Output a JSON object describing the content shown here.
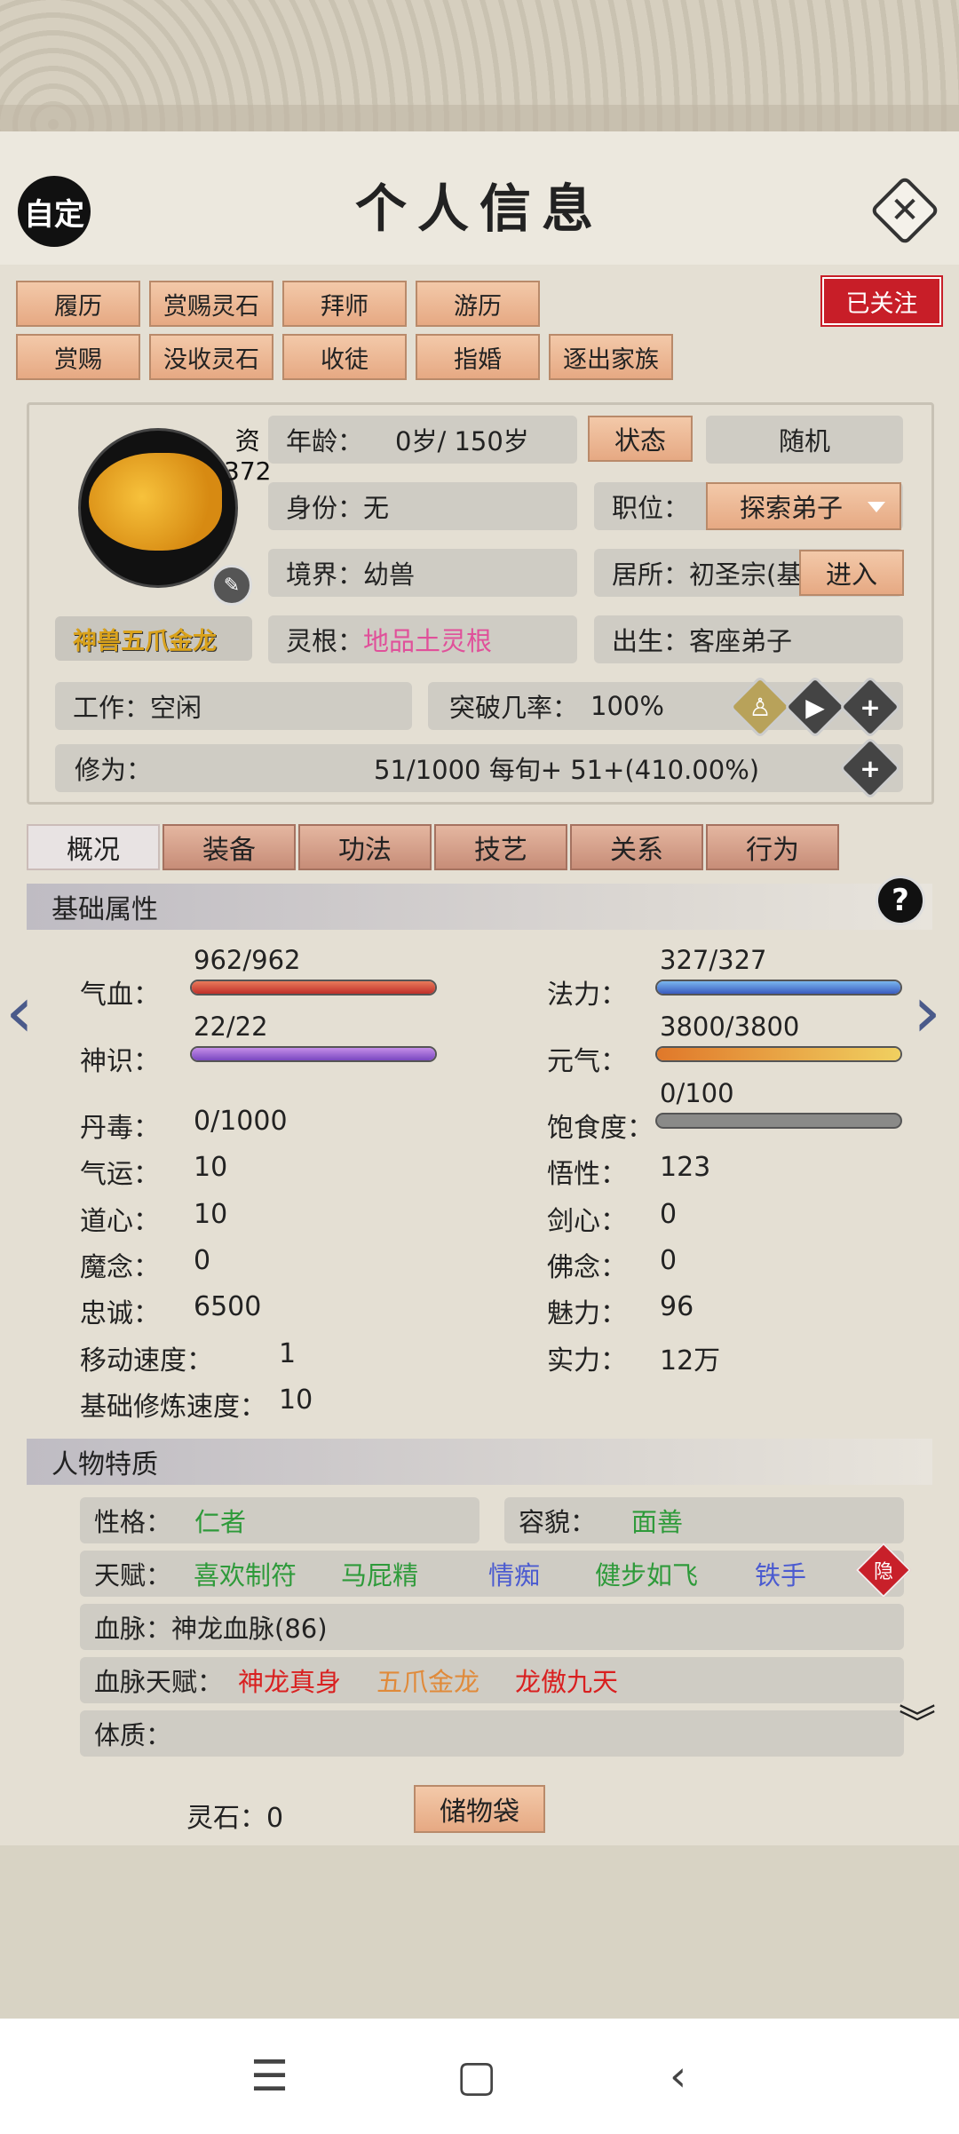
{
  "header": {
    "title": "个人信息",
    "auto_label": "自定"
  },
  "action_buttons": [
    "履历",
    "赏赐灵石",
    "拜师",
    "游历",
    "赏赐",
    "没收灵石",
    "收徒",
    "指婚",
    "逐出家族"
  ],
  "follow_label": "已关注",
  "profile": {
    "zi_label": "资",
    "zi_value": "372",
    "name": "神兽五爪金龙",
    "age_label": "年龄：",
    "age_value": "0岁/ 150岁",
    "status_btn": "状态",
    "random_btn": "随机",
    "identity_label": "身份：",
    "identity_value": "无",
    "position_label": "职位：",
    "position_value": "探索弟子",
    "realm_label": "境界：",
    "realm_value": "幼兽",
    "residence_label": "居所：初圣宗(基",
    "enter_btn": "进入",
    "root_label": "灵根：",
    "root_value": "地品土灵根",
    "birth_label": "出生：",
    "birth_value": "客座弟子",
    "work_label": "工作：空闲",
    "breakthrough_label": "突破几率：",
    "breakthrough_value": "100%",
    "cultivation_label": "修为：",
    "cultivation_value": "51/1000  每旬+  51+(410.00%)"
  },
  "tabs": [
    "概况",
    "装备",
    "功法",
    "技艺",
    "关系",
    "行为"
  ],
  "basic": {
    "section_title": "基础属性",
    "hp_label": "气血：",
    "hp_value": "962/962",
    "hp_frac": 1.0,
    "mp_label": "法力：",
    "mp_value": "327/327",
    "mp_frac": 1.0,
    "sense_label": "神识：",
    "sense_value": "22/22",
    "sense_frac": 1.0,
    "qi_label": "元气：",
    "qi_value": "3800/3800",
    "qi_frac": 1.0,
    "satiety_label": "饱食度：",
    "satiety_value": "0/100",
    "satiety_frac": 0.0,
    "left_stats": [
      {
        "label": "丹毒：",
        "value": "0/1000"
      },
      {
        "label": "气运：",
        "value": "10"
      },
      {
        "label": "道心：",
        "value": "10"
      },
      {
        "label": "魔念：",
        "value": "0"
      },
      {
        "label": "忠诚：",
        "value": "6500"
      },
      {
        "label": "移动速度：",
        "value": "1"
      },
      {
        "label": "基础修炼速度：",
        "value": "10"
      }
    ],
    "right_stats": [
      {
        "label": "悟性：",
        "value": "123"
      },
      {
        "label": "剑心：",
        "value": "0"
      },
      {
        "label": "佛念：",
        "value": "0"
      },
      {
        "label": "魅力：",
        "value": "96"
      },
      {
        "label": "实力：",
        "value": "12万"
      }
    ]
  },
  "traits": {
    "section_title": "人物特质",
    "personality_label": "性格：",
    "personality_value": "仁者",
    "looks_label": "容貌：",
    "looks_value": "面善",
    "talent_label": "天赋：",
    "talents": [
      "喜欢制符",
      "马屁精",
      "情痴",
      "健步如飞",
      "铁手"
    ],
    "hide_label": "隐",
    "bloodline_label": "血脉：神龙血脉(86)",
    "bloodline_talent_label": "血脉天赋：",
    "bloodline_talents": [
      "神龙真身",
      "五爪金龙",
      "龙傲九天"
    ],
    "physique_label": "体质："
  },
  "footer": {
    "lingshi_label": "灵石：0",
    "bag_label": "储物袋"
  },
  "colors": {
    "accent_red": "#c81e28",
    "green": "#2e9a3a",
    "blue": "#4b5bd0",
    "pink": "#e0509a"
  }
}
